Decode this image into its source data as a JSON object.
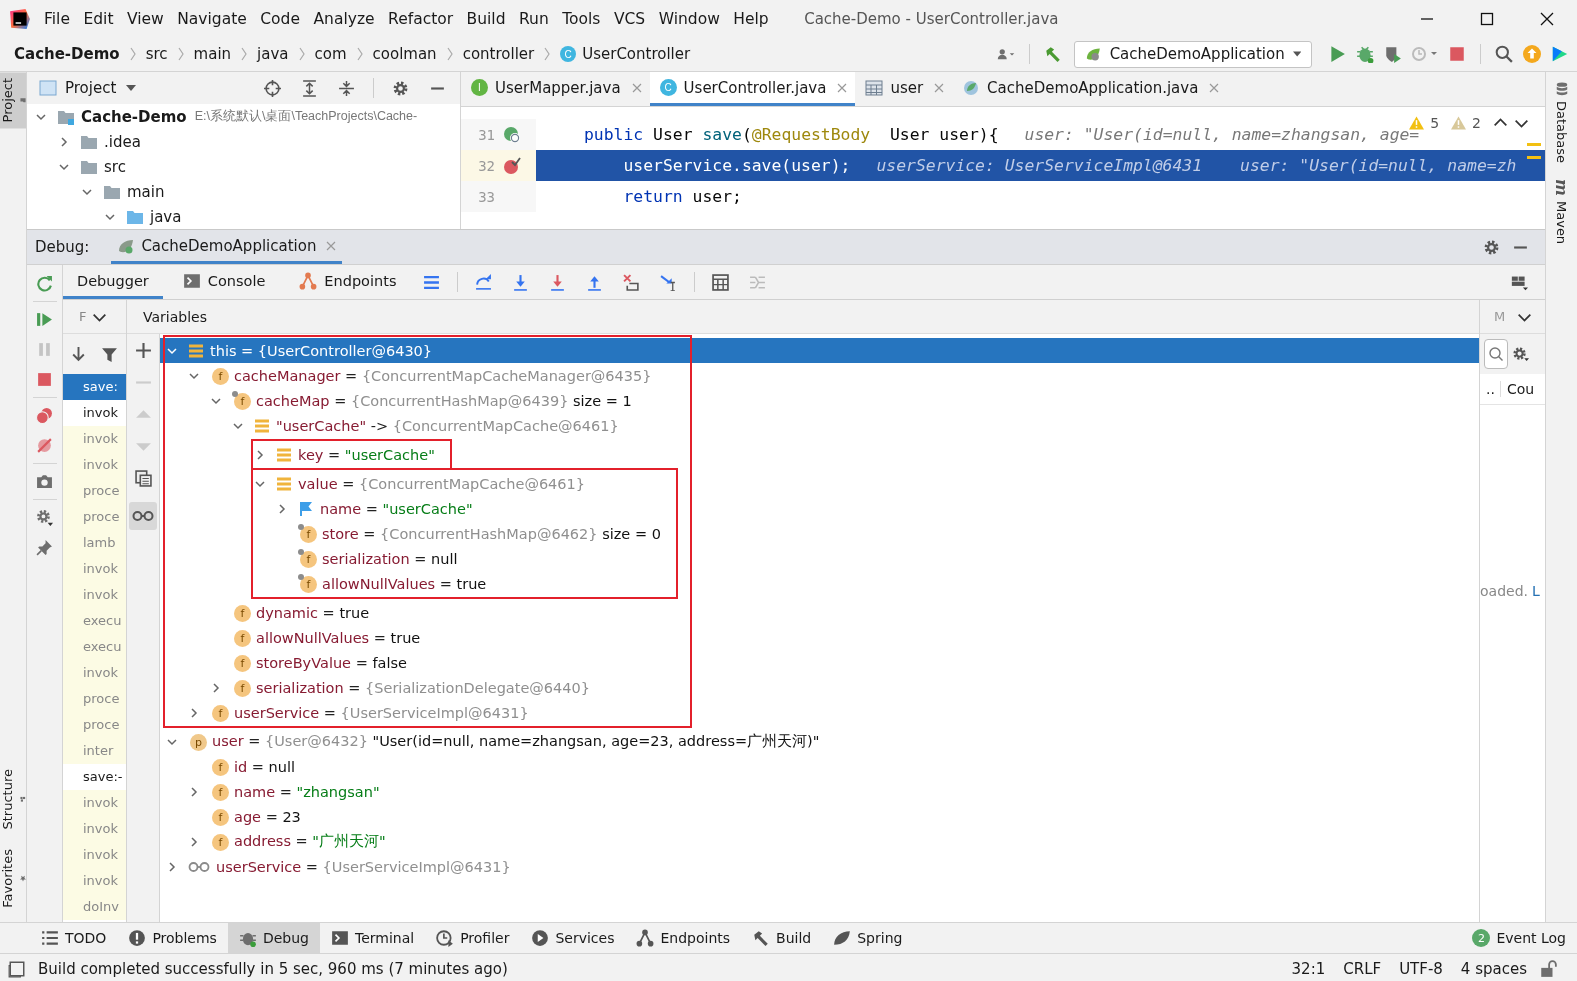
{
  "menu_bar": {
    "items": [
      "File",
      "Edit",
      "View",
      "Navigate",
      "Code",
      "Analyze",
      "Refactor",
      "Build",
      "Run",
      "Tools",
      "VCS",
      "Window",
      "Help"
    ],
    "title": "Cache-Demo - UserController.java"
  },
  "breadcrumbs": [
    {
      "label": "Cache-Demo",
      "kind": "project"
    },
    {
      "label": "src",
      "kind": "folder"
    },
    {
      "label": "main",
      "kind": "folder"
    },
    {
      "label": "java",
      "kind": "folder"
    },
    {
      "label": "com",
      "kind": "folder"
    },
    {
      "label": "coolman",
      "kind": "folder"
    },
    {
      "label": "controller",
      "kind": "folder"
    },
    {
      "label": "UserController",
      "kind": "class",
      "badge": "C"
    }
  ],
  "run_config": {
    "label": "CacheDemoApplication"
  },
  "left_stripe": {
    "top": [
      {
        "label": "Project",
        "kind": "project",
        "selected": true
      }
    ],
    "bottom": [
      {
        "label": "Structure",
        "kind": "structure",
        "selected": false
      },
      {
        "label": "Favorites",
        "kind": "favorites",
        "selected": false
      }
    ]
  },
  "right_stripe": [
    {
      "label": "Database",
      "kind": "database"
    },
    {
      "label": "Maven",
      "kind": "maven",
      "badge": "m"
    }
  ],
  "project": {
    "title": "Project",
    "tree": [
      {
        "name": "Cache-Demo",
        "path": "E:\\系统默认\\桌面\\TeachProjects\\Cache-",
        "kind": "module",
        "expanded": true,
        "children": [
          {
            "name": ".idea",
            "kind": "folder",
            "expanded": false
          },
          {
            "name": "src",
            "kind": "folder",
            "expanded": true,
            "children": [
              {
                "name": "main",
                "kind": "folder",
                "expanded": true,
                "children": [
                  {
                    "name": "java",
                    "kind": "source",
                    "expanded": true
                  }
                ]
              }
            ]
          }
        ]
      }
    ]
  },
  "editor": {
    "tabs": [
      {
        "label": "UserMapper.java",
        "kind": "interface",
        "badge": "I",
        "selected": false
      },
      {
        "label": "UserController.java",
        "kind": "class",
        "badge": "C",
        "selected": true
      },
      {
        "label": "user",
        "kind": "table",
        "selected": false
      },
      {
        "label": "CacheDemoApplication.java",
        "kind": "app",
        "selected": false
      }
    ],
    "inspections": [
      {
        "count": "5",
        "kind": "warning"
      },
      {
        "count": "2",
        "kind": "weak"
      }
    ],
    "lines": [
      {
        "number": "31",
        "kind": "mapping",
        "current": false,
        "segments": [
          {
            "text": "public",
            "kind": "keyword"
          },
          {
            "text": " User ",
            "kind": "plain"
          },
          {
            "text": "save",
            "kind": "method"
          },
          {
            "text": "(",
            "kind": "plain"
          },
          {
            "text": "@RequestBody",
            "kind": "annotation"
          },
          {
            "text": "  User user){",
            "kind": "plain"
          }
        ],
        "hints": [
          "user: \"User(id=null, name=zhangsan, age="
        ]
      },
      {
        "number": "32",
        "kind": "breakpoint",
        "current": true,
        "segments": [
          {
            "text": "    userService.save(user);",
            "kind": "plain"
          }
        ],
        "hints": [
          "userService: UserServiceImpl@6431",
          "user: \"User(id=null, name=zh"
        ]
      },
      {
        "number": "33",
        "kind": "plain",
        "current": false,
        "segments": [
          {
            "text": "    return",
            "kind": "keyword"
          },
          {
            "text": " user;",
            "kind": "plain"
          }
        ]
      }
    ]
  },
  "debug": {
    "title": "Debug:",
    "session": "CacheDemoApplication",
    "tabs": [
      {
        "label": "Debugger",
        "kind": "plain",
        "selected": true
      },
      {
        "label": "Console",
        "kind": "console",
        "selected": false
      },
      {
        "label": "Endpoints",
        "kind": "endpoints",
        "selected": false
      }
    ],
    "frames_header": "F",
    "variables_header": "Variables",
    "frames": [
      {
        "label": "save:",
        "selected": true,
        "library": false
      },
      {
        "label": "invok",
        "selected": false,
        "library": false
      },
      {
        "label": "invok",
        "selected": false,
        "library": true
      },
      {
        "label": "invok",
        "selected": false,
        "library": true
      },
      {
        "label": "proce",
        "selected": false,
        "library": true
      },
      {
        "label": "proce",
        "selected": false,
        "library": true
      },
      {
        "label": "lamb",
        "selected": false,
        "library": true
      },
      {
        "label": "invok",
        "selected": false,
        "library": true
      },
      {
        "label": "invok",
        "selected": false,
        "library": true
      },
      {
        "label": "execu",
        "selected": false,
        "library": true
      },
      {
        "label": "execu",
        "selected": false,
        "library": true
      },
      {
        "label": "invok",
        "selected": false,
        "library": true
      },
      {
        "label": "proce",
        "selected": false,
        "library": true
      },
      {
        "label": "proce",
        "selected": false,
        "library": true
      },
      {
        "label": "inter",
        "selected": false,
        "library": true
      },
      {
        "label": "save:-",
        "selected": false,
        "library": false
      },
      {
        "label": "invok",
        "selected": false,
        "library": true
      },
      {
        "label": "invok",
        "selected": false,
        "library": true
      },
      {
        "label": "invok",
        "selected": false,
        "library": true
      },
      {
        "label": "invok",
        "selected": false,
        "library": true
      },
      {
        "label": "doInv",
        "selected": false,
        "library": true
      }
    ],
    "variables": [
      {
        "name": "this",
        "separator": "=",
        "ref": "{UserController@6430}",
        "kind": "object",
        "expanded": true,
        "selected": true,
        "highlighted": true,
        "children": [
          {
            "name": "cacheManager",
            "separator": "=",
            "ref": "{ConcurrentMapCacheManager@6435}",
            "kind": "field",
            "badge": "f",
            "expanded": true,
            "selected": false,
            "children": [
              {
                "name": "cacheMap",
                "separator": "=",
                "ref": "{ConcurrentHashMap@6439}",
                "extra": "size = 1",
                "kind": "final_field",
                "badge": "f",
                "expanded": true,
                "selected": false,
                "children": [
                  {
                    "name": "\"userCache\"",
                    "separator": "->",
                    "ref": "{ConcurrentMapCache@6461}",
                    "kind": "object",
                    "expanded": true,
                    "selected": false,
                    "children": [
                      {
                        "name": "key",
                        "separator": "=",
                        "value": {
                          "text": "\"userCache\"",
                          "kind": "string"
                        },
                        "kind": "object",
                        "expanded": false,
                        "selected": false,
                        "highlighted": true
                      },
                      {
                        "name": "value",
                        "separator": "=",
                        "ref": "{ConcurrentMapCache@6461}",
                        "kind": "object",
                        "expanded": true,
                        "selected": false,
                        "highlighted": true,
                        "children": [
                          {
                            "name": "name",
                            "separator": "=",
                            "value": {
                              "text": "\"userCache\"",
                              "kind": "string"
                            },
                            "kind": "flag",
                            "expanded": false,
                            "selected": false
                          },
                          {
                            "name": "store",
                            "separator": "=",
                            "ref": "{ConcurrentHashMap@6462}",
                            "extra": "size = 0",
                            "kind": "final_field",
                            "badge": "f",
                            "selected": false
                          },
                          {
                            "name": "serialization",
                            "separator": "=",
                            "value": {
                              "text": "null",
                              "kind": "plain"
                            },
                            "kind": "final_field",
                            "badge": "f",
                            "selected": false
                          },
                          {
                            "name": "allowNullValues",
                            "separator": "=",
                            "value": {
                              "text": "true",
                              "kind": "plain"
                            },
                            "kind": "final_field",
                            "badge": "f",
                            "selected": false
                          }
                        ]
                      }
                    ]
                  }
                ]
              },
              {
                "name": "dynamic",
                "separator": "=",
                "value": {
                  "text": "true",
                  "kind": "plain"
                },
                "kind": "field",
                "badge": "f",
                "selected": false
              },
              {
                "name": "allowNullValues",
                "separator": "=",
                "value": {
                  "text": "true",
                  "kind": "plain"
                },
                "kind": "field",
                "badge": "f",
                "selected": false
              },
              {
                "name": "storeByValue",
                "separator": "=",
                "value": {
                  "text": "false",
                  "kind": "plain"
                },
                "kind": "field",
                "badge": "f",
                "selected": false
              },
              {
                "name": "serialization",
                "separator": "=",
                "ref": "{SerializationDelegate@6440}",
                "kind": "field",
                "badge": "f",
                "expanded": false,
                "selected": false
              }
            ]
          },
          {
            "name": "userService",
            "separator": "=",
            "ref": "{UserServiceImpl@6431}",
            "kind": "field",
            "badge": "f",
            "expanded": false,
            "selected": false
          }
        ]
      },
      {
        "name": "user",
        "separator": "=",
        "ref": "{User@6432}",
        "value": {
          "text": "\"User(id=null, name=zhangsan, age=23, address=广州天河)\"",
          "kind": "plain"
        },
        "kind": "param",
        "badge": "p",
        "expanded": true,
        "selected": false,
        "children": [
          {
            "name": "id",
            "separator": "=",
            "value": {
              "text": "null",
              "kind": "plain"
            },
            "kind": "field",
            "badge": "f",
            "selected": false
          },
          {
            "name": "name",
            "separator": "=",
            "value": {
              "text": "\"zhangsan\"",
              "kind": "string"
            },
            "kind": "field",
            "badge": "f",
            "expanded": false,
            "selected": false
          },
          {
            "name": "age",
            "separator": "=",
            "value": {
              "text": "23",
              "kind": "plain"
            },
            "kind": "field",
            "badge": "f",
            "selected": false
          },
          {
            "name": "address",
            "separator": "=",
            "value": {
              "text": "\"广州天河\"",
              "kind": "string"
            },
            "kind": "field",
            "badge": "f",
            "expanded": false,
            "selected": false
          }
        ]
      },
      {
        "name": "userService",
        "separator": "=",
        "ref": "{UserServiceImpl@6431}",
        "kind": "watch",
        "expanded": false,
        "selected": false
      }
    ],
    "side": {
      "header": "M",
      "column": "..",
      "column_2": "Cou",
      "message": "oaded.",
      "link": "L"
    }
  },
  "tool_windows": [
    {
      "label": "TODO",
      "kind": "todo",
      "selected": false
    },
    {
      "label": "Problems",
      "kind": "problems",
      "selected": false
    },
    {
      "label": "Debug",
      "kind": "debug",
      "selected": true
    },
    {
      "label": "Terminal",
      "kind": "terminal",
      "selected": false
    },
    {
      "label": "Profiler",
      "kind": "profiler",
      "selected": false
    },
    {
      "label": "Services",
      "kind": "services",
      "selected": false
    },
    {
      "label": "Endpoints",
      "kind": "endpoints",
      "selected": false
    },
    {
      "label": "Build",
      "kind": "build",
      "selected": false
    },
    {
      "label": "Spring",
      "kind": "spring",
      "selected": false
    }
  ],
  "event_log": {
    "badge": "2",
    "label": "Event Log"
  },
  "status_bar": {
    "message": "Build completed successfully in 5 sec, 960 ms (7 minutes ago)",
    "items": [
      "32:1",
      "CRLF",
      "UTF-8",
      "4 spaces"
    ]
  }
}
